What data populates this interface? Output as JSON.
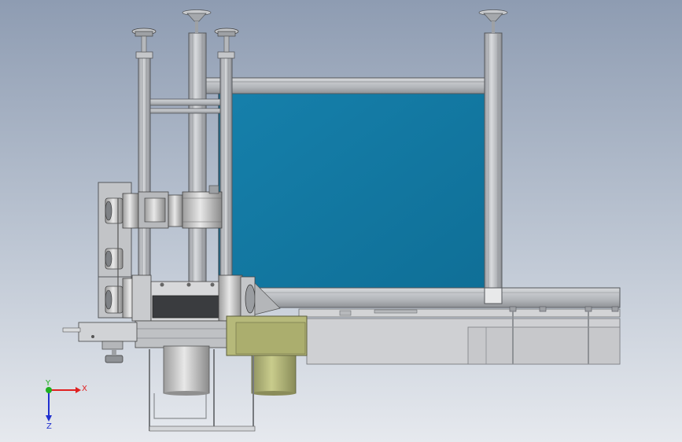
{
  "triad": {
    "x_label": "X",
    "y_label": "Y",
    "z_label": "Z",
    "x_color": "#e02020",
    "y_color": "#20b020",
    "z_color": "#2030d0"
  },
  "colors": {
    "panel": "#137aa4",
    "frame": "#b9bcc1",
    "frame_dark": "#6f7277",
    "motor_yellow": "#b6b97a",
    "motor_grey": "#cfcfcf"
  }
}
